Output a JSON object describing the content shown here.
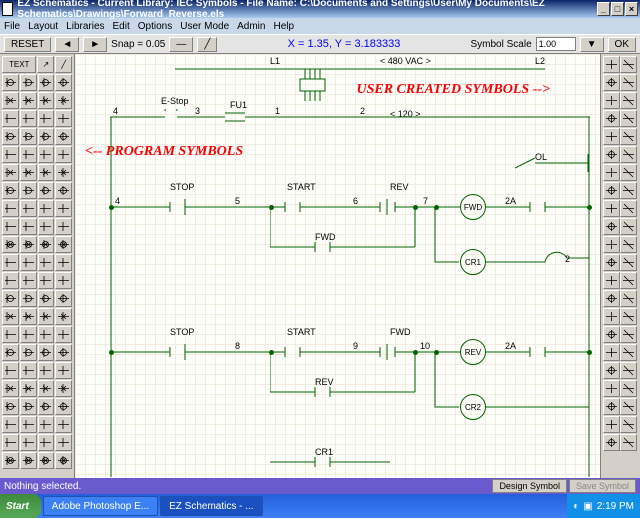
{
  "title": "EZ Schematics - Current Library: IEC Symbols - File Name: C:\\Documents and Settings\\User\\My Documents\\EZ Schematics\\Drawings\\Forward_Reverse.els",
  "menu": [
    "File",
    "Layout",
    "Libraries",
    "Edit",
    "Options",
    "User Mode",
    "Admin",
    "Help"
  ],
  "toolbar": {
    "reset": "RESET",
    "snap_label": "Snap = 0.05",
    "coords": "X = 1.35, Y = 3.183333",
    "scale_label": "Symbol Scale",
    "scale_val": "1.00",
    "ok": "OK"
  },
  "annotations": {
    "left": "<-- PROGRAM SYMBOLS",
    "right": "USER CREATED SYMBOLS -->"
  },
  "status": {
    "msg": "Nothing selected.",
    "design": "Design Symbol",
    "save": "Save Symbol"
  },
  "taskbar": {
    "start": "Start",
    "t1": "Adobe Photoshop E...",
    "t2": "EZ Schematics - ...",
    "time": "2:19 PM"
  },
  "sch": {
    "L1": "L1",
    "L2": "L2",
    "v480": "< 480 VAC >",
    "v120": "< 120 >",
    "estop": "E-Stop",
    "fu1": "FU1",
    "stop": "STOP",
    "start": "START",
    "rev": "REV",
    "fwd": "FWD",
    "ol": "OL",
    "cr1": "CR1",
    "cr2": "CR2",
    "2a": "2A",
    "2": "2",
    "n1": "1",
    "n2": "2",
    "n3": "3",
    "n4": "4",
    "n5": "5",
    "n6": "6",
    "n7": "7",
    "n8": "8",
    "n9": "9",
    "n10": "10"
  },
  "texttool": "TEXT"
}
